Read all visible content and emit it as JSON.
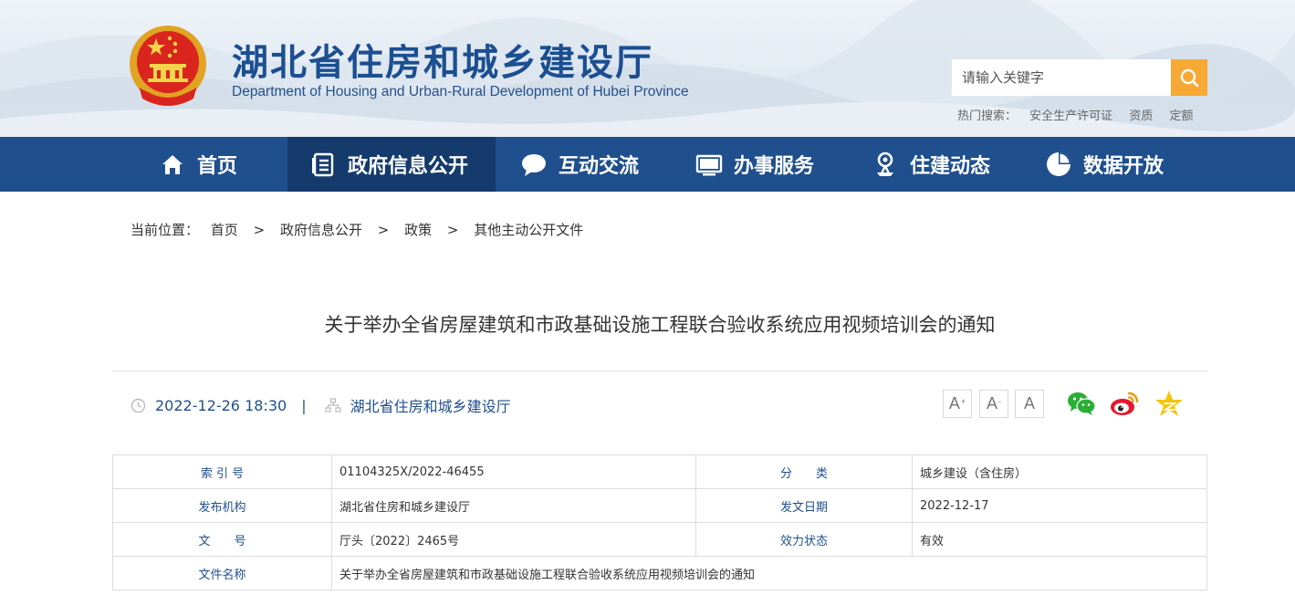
{
  "header": {
    "title": "湖北省住房和城乡建设厅",
    "subtitle": "Department of Housing and Urban-Rural Development of Hubei Province",
    "search_placeholder": "请输入关键字",
    "hot_label": "热门搜索：",
    "hot_links": [
      "安全生产许可证",
      "资质",
      "定额"
    ]
  },
  "nav": {
    "items": [
      {
        "label": "首页",
        "icon": "home-icon"
      },
      {
        "label": "政府信息公开",
        "icon": "document-list-icon"
      },
      {
        "label": "互动交流",
        "icon": "chat-bubble-icon"
      },
      {
        "label": "办事服务",
        "icon": "monitor-icon"
      },
      {
        "label": "住建动态",
        "icon": "location-pin-icon"
      },
      {
        "label": "数据开放",
        "icon": "pie-chart-icon"
      }
    ],
    "active_index": 1
  },
  "breadcrumb": {
    "label": "当前位置：",
    "items": [
      "首页",
      "政府信息公开",
      "政策",
      "其他主动公开文件"
    ],
    "separator": ">"
  },
  "article": {
    "title": "关于举办全省房屋建筑和市政基础设施工程联合验收系统应用视频培训会的通知",
    "datetime": "2022-12-26 18:30",
    "divider": "|",
    "source": "湖北省住房和城乡建设厅",
    "font_buttons": [
      "A",
      "A",
      "A"
    ],
    "font_button_marks": [
      "+",
      "-",
      ""
    ],
    "share_icons": [
      "wechat-icon",
      "weibo-icon",
      "qzone-icon"
    ]
  },
  "info_table": {
    "index_label": "索 引 号",
    "index_value": "01104325X/2022-46455",
    "category_label": "分　　类",
    "category_value": "城乡建设（含住房）",
    "publisher_label": "发布机构",
    "publisher_value": "湖北省住房和城乡建设厅",
    "date_label": "发文日期",
    "date_value": "2022-12-17",
    "docno_label": "文　　号",
    "docno_value": "厅头〔2022〕2465号",
    "status_label": "效力状态",
    "status_value": "有效",
    "filename_label": "文件名称",
    "filename_value": "关于举办全省房屋建筑和市政基础设施工程联合验收系统应用视频培训会的通知"
  },
  "colors": {
    "brand_blue": "#1f4f8c",
    "nav_active": "#153a6c",
    "search_orange": "#f7a936",
    "wechat_green": "#2aae36",
    "weibo_orange": "#e6162d",
    "qzone_yellow": "#f5c300"
  }
}
